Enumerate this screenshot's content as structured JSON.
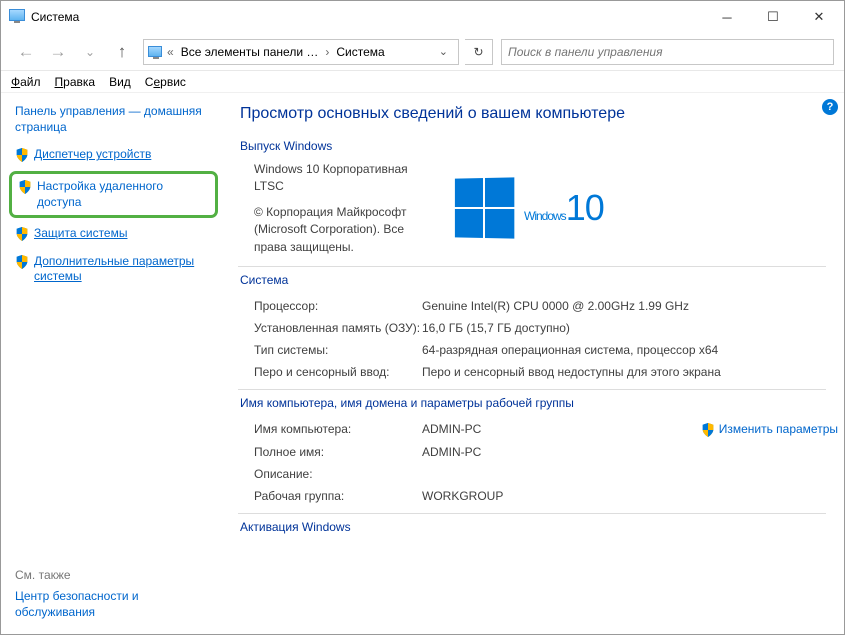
{
  "window": {
    "title": "Система"
  },
  "nav": {
    "crumb1": "Все элементы панели …",
    "crumb2": "Система",
    "search_placeholder": "Поиск в панели управления"
  },
  "menu": {
    "file": "Файл",
    "edit": "Правка",
    "view": "Вид",
    "service": "Сервис"
  },
  "sidebar": {
    "home": "Панель управления — домашняя страница",
    "items": [
      {
        "label": "Диспетчер устройств"
      },
      {
        "label": "Настройка удаленного доступа"
      },
      {
        "label": "Защита системы"
      },
      {
        "label": "Дополнительные параметры системы"
      }
    ],
    "see_also_h": "См. также",
    "see_also_item": "Центр безопасности и обслуживания"
  },
  "main": {
    "heading": "Просмотр основных сведений о вашем компьютере",
    "edition_h": "Выпуск Windows",
    "edition_name": "Windows 10 Корпоративная LTSC",
    "copyright": "© Корпорация Майкрософт (Microsoft Corporation). Все права защищены.",
    "winlogo_text": "Windows",
    "winlogo_num": "10",
    "system_h": "Система",
    "system": [
      {
        "k": "Процессор:",
        "v": "Genuine Intel(R) CPU 0000 @ 2.00GHz   1.99 GHz"
      },
      {
        "k": "Установленная память (ОЗУ):",
        "v": "16,0 ГБ (15,7 ГБ доступно)"
      },
      {
        "k": "Тип системы:",
        "v": "64-разрядная операционная система, процессор x64"
      },
      {
        "k": "Перо и сенсорный ввод:",
        "v": "Перо и сенсорный ввод недоступны для этого экрана"
      }
    ],
    "name_h": "Имя компьютера, имя домена и параметры рабочей группы",
    "name": [
      {
        "k": "Имя компьютера:",
        "v": "ADMIN-PC"
      },
      {
        "k": "Полное имя:",
        "v": "ADMIN-PC"
      },
      {
        "k": "Описание:",
        "v": ""
      },
      {
        "k": "Рабочая группа:",
        "v": "WORKGROUP"
      }
    ],
    "change_link": "Изменить параметры",
    "activation_h": "Активация Windows"
  }
}
